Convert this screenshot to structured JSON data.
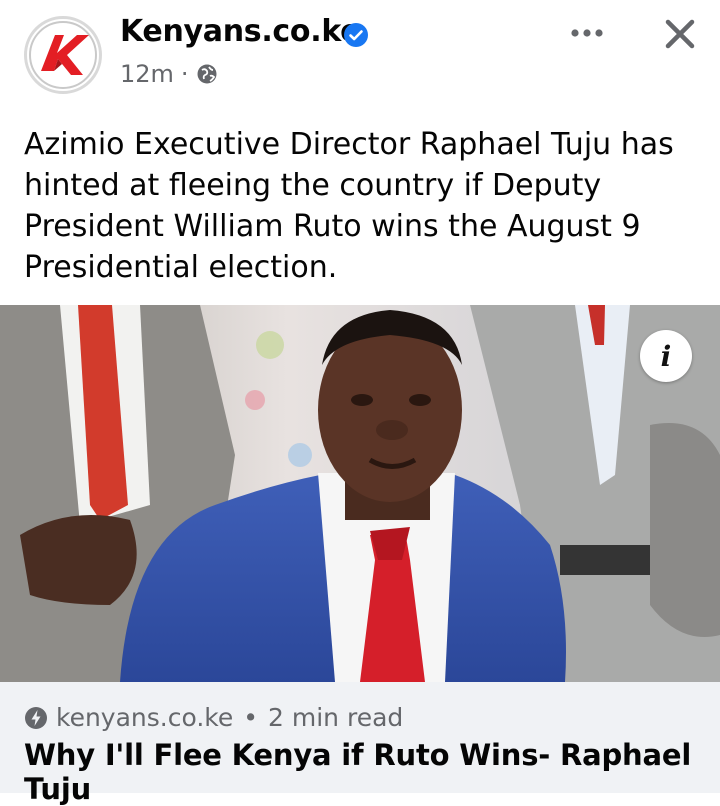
{
  "header": {
    "page_name": "Kenyans.co.ke",
    "time_ago": "12m",
    "separator": "·",
    "avatar_icon": "kenyans-logo-icon",
    "verified_icon": "verified-badge-icon",
    "privacy_icon": "globe-icon",
    "more_icon": "more-options-icon",
    "close_icon": "close-icon"
  },
  "post": {
    "text": "Azimio Executive Director Raphael Tuju has hinted at fleeing the country if Deputy President William Ruto wins the August 9 Presidential election."
  },
  "photo": {
    "info_label": "i"
  },
  "link_card": {
    "domain": "kenyans.co.ke",
    "separator": "•",
    "read_time": "2 min read",
    "title": "Why I'll Flee Kenya if Ruto Wins- Raphael Tuju",
    "icon": "instant-article-bolt-icon"
  },
  "colors": {
    "accent_blue": "#1877f2",
    "logo_red": "#e31e24",
    "secondary_text": "#65676b"
  }
}
